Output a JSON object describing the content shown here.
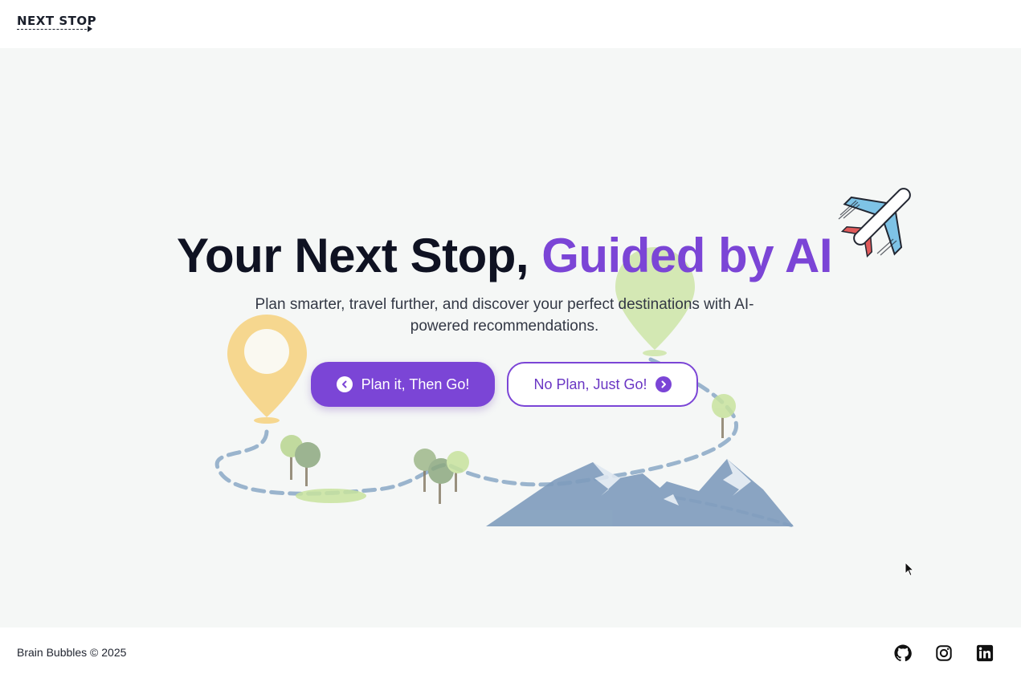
{
  "header": {
    "logo_text": "NEXT STOP"
  },
  "hero": {
    "title_main": "Your Next Stop, ",
    "title_accent": "Guided by AI",
    "subtitle": "Plan smarter, travel further, and discover your perfect destinations with AI-powered recommendations.",
    "primary_button": "Plan it, Then Go!",
    "secondary_button": "No Plan, Just Go!"
  },
  "footer": {
    "copyright": "Brain Bubbles © 2025",
    "social_links": [
      "github-icon",
      "instagram-icon",
      "linkedin-icon"
    ]
  },
  "colors": {
    "accent": "#7b45d6",
    "title": "#0f1222",
    "background": "#f5f7f6",
    "pin_yellow": "#f7d27e",
    "pin_green": "#c8e39d",
    "mountain": "#7f9cbd",
    "trail": "#8aa8c6"
  }
}
